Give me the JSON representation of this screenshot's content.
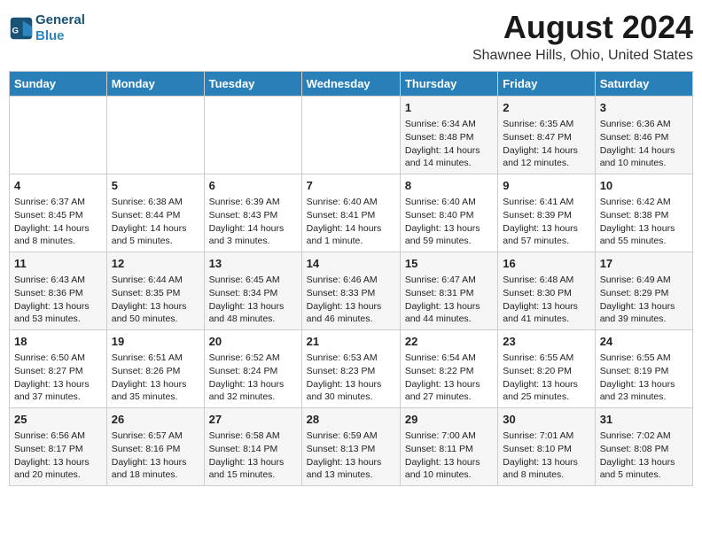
{
  "header": {
    "logo_line1": "General",
    "logo_line2": "Blue",
    "title": "August 2024",
    "subtitle": "Shawnee Hills, Ohio, United States"
  },
  "weekdays": [
    "Sunday",
    "Monday",
    "Tuesday",
    "Wednesday",
    "Thursday",
    "Friday",
    "Saturday"
  ],
  "weeks": [
    [
      {
        "day": "",
        "info": ""
      },
      {
        "day": "",
        "info": ""
      },
      {
        "day": "",
        "info": ""
      },
      {
        "day": "",
        "info": ""
      },
      {
        "day": "1",
        "info": "Sunrise: 6:34 AM\nSunset: 8:48 PM\nDaylight: 14 hours and 14 minutes."
      },
      {
        "day": "2",
        "info": "Sunrise: 6:35 AM\nSunset: 8:47 PM\nDaylight: 14 hours and 12 minutes."
      },
      {
        "day": "3",
        "info": "Sunrise: 6:36 AM\nSunset: 8:46 PM\nDaylight: 14 hours and 10 minutes."
      }
    ],
    [
      {
        "day": "4",
        "info": "Sunrise: 6:37 AM\nSunset: 8:45 PM\nDaylight: 14 hours and 8 minutes."
      },
      {
        "day": "5",
        "info": "Sunrise: 6:38 AM\nSunset: 8:44 PM\nDaylight: 14 hours and 5 minutes."
      },
      {
        "day": "6",
        "info": "Sunrise: 6:39 AM\nSunset: 8:43 PM\nDaylight: 14 hours and 3 minutes."
      },
      {
        "day": "7",
        "info": "Sunrise: 6:40 AM\nSunset: 8:41 PM\nDaylight: 14 hours and 1 minute."
      },
      {
        "day": "8",
        "info": "Sunrise: 6:40 AM\nSunset: 8:40 PM\nDaylight: 13 hours and 59 minutes."
      },
      {
        "day": "9",
        "info": "Sunrise: 6:41 AM\nSunset: 8:39 PM\nDaylight: 13 hours and 57 minutes."
      },
      {
        "day": "10",
        "info": "Sunrise: 6:42 AM\nSunset: 8:38 PM\nDaylight: 13 hours and 55 minutes."
      }
    ],
    [
      {
        "day": "11",
        "info": "Sunrise: 6:43 AM\nSunset: 8:36 PM\nDaylight: 13 hours and 53 minutes."
      },
      {
        "day": "12",
        "info": "Sunrise: 6:44 AM\nSunset: 8:35 PM\nDaylight: 13 hours and 50 minutes."
      },
      {
        "day": "13",
        "info": "Sunrise: 6:45 AM\nSunset: 8:34 PM\nDaylight: 13 hours and 48 minutes."
      },
      {
        "day": "14",
        "info": "Sunrise: 6:46 AM\nSunset: 8:33 PM\nDaylight: 13 hours and 46 minutes."
      },
      {
        "day": "15",
        "info": "Sunrise: 6:47 AM\nSunset: 8:31 PM\nDaylight: 13 hours and 44 minutes."
      },
      {
        "day": "16",
        "info": "Sunrise: 6:48 AM\nSunset: 8:30 PM\nDaylight: 13 hours and 41 minutes."
      },
      {
        "day": "17",
        "info": "Sunrise: 6:49 AM\nSunset: 8:29 PM\nDaylight: 13 hours and 39 minutes."
      }
    ],
    [
      {
        "day": "18",
        "info": "Sunrise: 6:50 AM\nSunset: 8:27 PM\nDaylight: 13 hours and 37 minutes."
      },
      {
        "day": "19",
        "info": "Sunrise: 6:51 AM\nSunset: 8:26 PM\nDaylight: 13 hours and 35 minutes."
      },
      {
        "day": "20",
        "info": "Sunrise: 6:52 AM\nSunset: 8:24 PM\nDaylight: 13 hours and 32 minutes."
      },
      {
        "day": "21",
        "info": "Sunrise: 6:53 AM\nSunset: 8:23 PM\nDaylight: 13 hours and 30 minutes."
      },
      {
        "day": "22",
        "info": "Sunrise: 6:54 AM\nSunset: 8:22 PM\nDaylight: 13 hours and 27 minutes."
      },
      {
        "day": "23",
        "info": "Sunrise: 6:55 AM\nSunset: 8:20 PM\nDaylight: 13 hours and 25 minutes."
      },
      {
        "day": "24",
        "info": "Sunrise: 6:55 AM\nSunset: 8:19 PM\nDaylight: 13 hours and 23 minutes."
      }
    ],
    [
      {
        "day": "25",
        "info": "Sunrise: 6:56 AM\nSunset: 8:17 PM\nDaylight: 13 hours and 20 minutes."
      },
      {
        "day": "26",
        "info": "Sunrise: 6:57 AM\nSunset: 8:16 PM\nDaylight: 13 hours and 18 minutes."
      },
      {
        "day": "27",
        "info": "Sunrise: 6:58 AM\nSunset: 8:14 PM\nDaylight: 13 hours and 15 minutes."
      },
      {
        "day": "28",
        "info": "Sunrise: 6:59 AM\nSunset: 8:13 PM\nDaylight: 13 hours and 13 minutes."
      },
      {
        "day": "29",
        "info": "Sunrise: 7:00 AM\nSunset: 8:11 PM\nDaylight: 13 hours and 10 minutes."
      },
      {
        "day": "30",
        "info": "Sunrise: 7:01 AM\nSunset: 8:10 PM\nDaylight: 13 hours and 8 minutes."
      },
      {
        "day": "31",
        "info": "Sunrise: 7:02 AM\nSunset: 8:08 PM\nDaylight: 13 hours and 5 minutes."
      }
    ]
  ]
}
